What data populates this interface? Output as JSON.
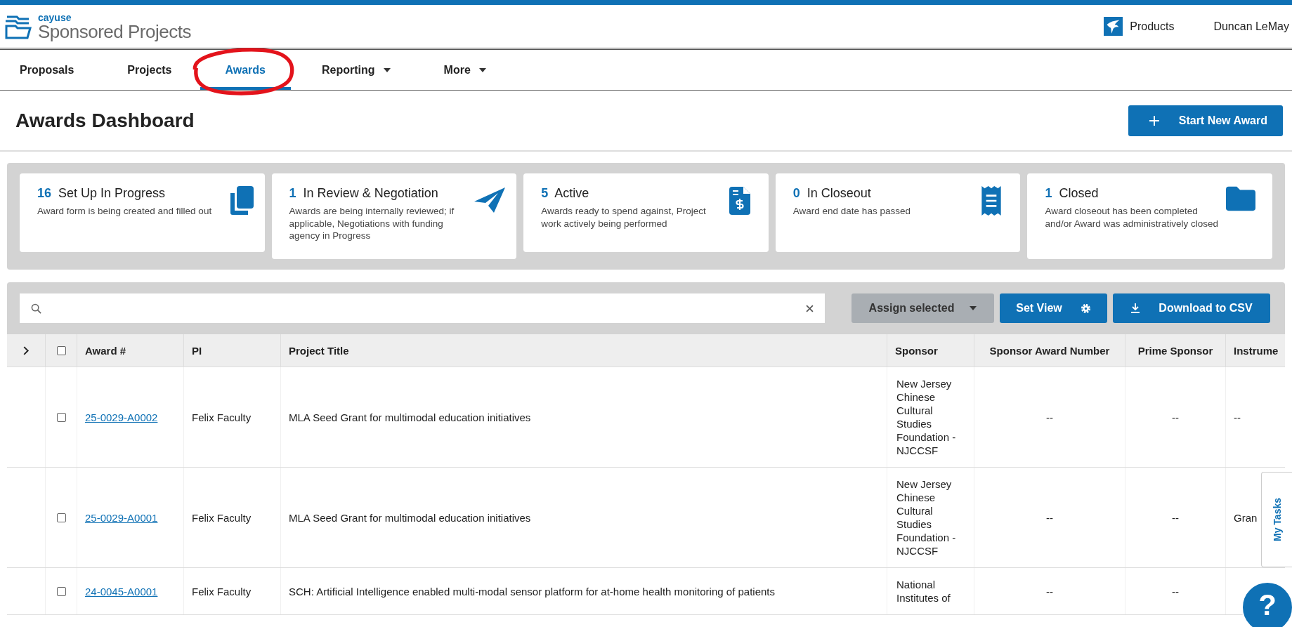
{
  "header": {
    "brand_small": "cayuse",
    "brand_large": "Sponsored Projects",
    "products": "Products",
    "user": "Duncan LeMay"
  },
  "tabs": [
    {
      "label": "Proposals",
      "selected": false,
      "has_menu": false
    },
    {
      "label": "Projects",
      "selected": false,
      "has_menu": false
    },
    {
      "label": "Awards",
      "selected": true,
      "has_menu": false
    },
    {
      "label": "Reporting",
      "selected": false,
      "has_menu": true
    },
    {
      "label": "More",
      "selected": false,
      "has_menu": true
    }
  ],
  "page_title": "Awards Dashboard",
  "start_button": "Start New Award",
  "status_cards": [
    {
      "count": "16",
      "title": "Set Up In Progress",
      "description": "Award form is being created and filled out"
    },
    {
      "count": "1",
      "title": "In Review & Negotiation",
      "description": "Awards are being internally reviewed; if applicable, Negotiations with funding agency in Progress"
    },
    {
      "count": "5",
      "title": "Active",
      "description": "Awards ready to spend against, Project work actively being performed"
    },
    {
      "count": "0",
      "title": "In Closeout",
      "description": "Award end date has passed"
    },
    {
      "count": "1",
      "title": "Closed",
      "description": "Award closeout has been completed and/or Award was administratively closed"
    }
  ],
  "toolbar": {
    "assign_button": "Assign selected",
    "set_view_button": "Set View",
    "download_button": "Download to CSV"
  },
  "table": {
    "header_checked": false,
    "columns": [
      "Award #",
      "PI",
      "Project Title",
      "Sponsor",
      "Sponsor Award Number",
      "Prime Sponsor",
      "Instrume"
    ],
    "rows": [
      {
        "checked": false,
        "award": "25-0029-A0002",
        "pi": "Felix Faculty",
        "title": "MLA Seed Grant for multimodal education initiatives",
        "sponsor": "New Jersey Chinese Cultural Studies Foundation - NJCCSF",
        "sponsor_award_number": "--",
        "prime_sponsor": "--",
        "instrument": "--"
      },
      {
        "checked": false,
        "award": "25-0029-A0001",
        "pi": "Felix Faculty",
        "title": "MLA Seed Grant for multimodal education initiatives",
        "sponsor": "New Jersey Chinese Cultural Studies Foundation - NJCCSF",
        "sponsor_award_number": "--",
        "prime_sponsor": "--",
        "instrument": "Gran"
      },
      {
        "checked": false,
        "award": "24-0045-A0001",
        "pi": "Felix Faculty",
        "title": "SCH: Artificial Intelligence enabled multi-modal sensor platform for at-home health monitoring of patients",
        "sponsor": "National Institutes of",
        "sponsor_award_number": "--",
        "prime_sponsor": "--"
      }
    ]
  },
  "my_tasks": "My Tasks",
  "help_button": "?"
}
